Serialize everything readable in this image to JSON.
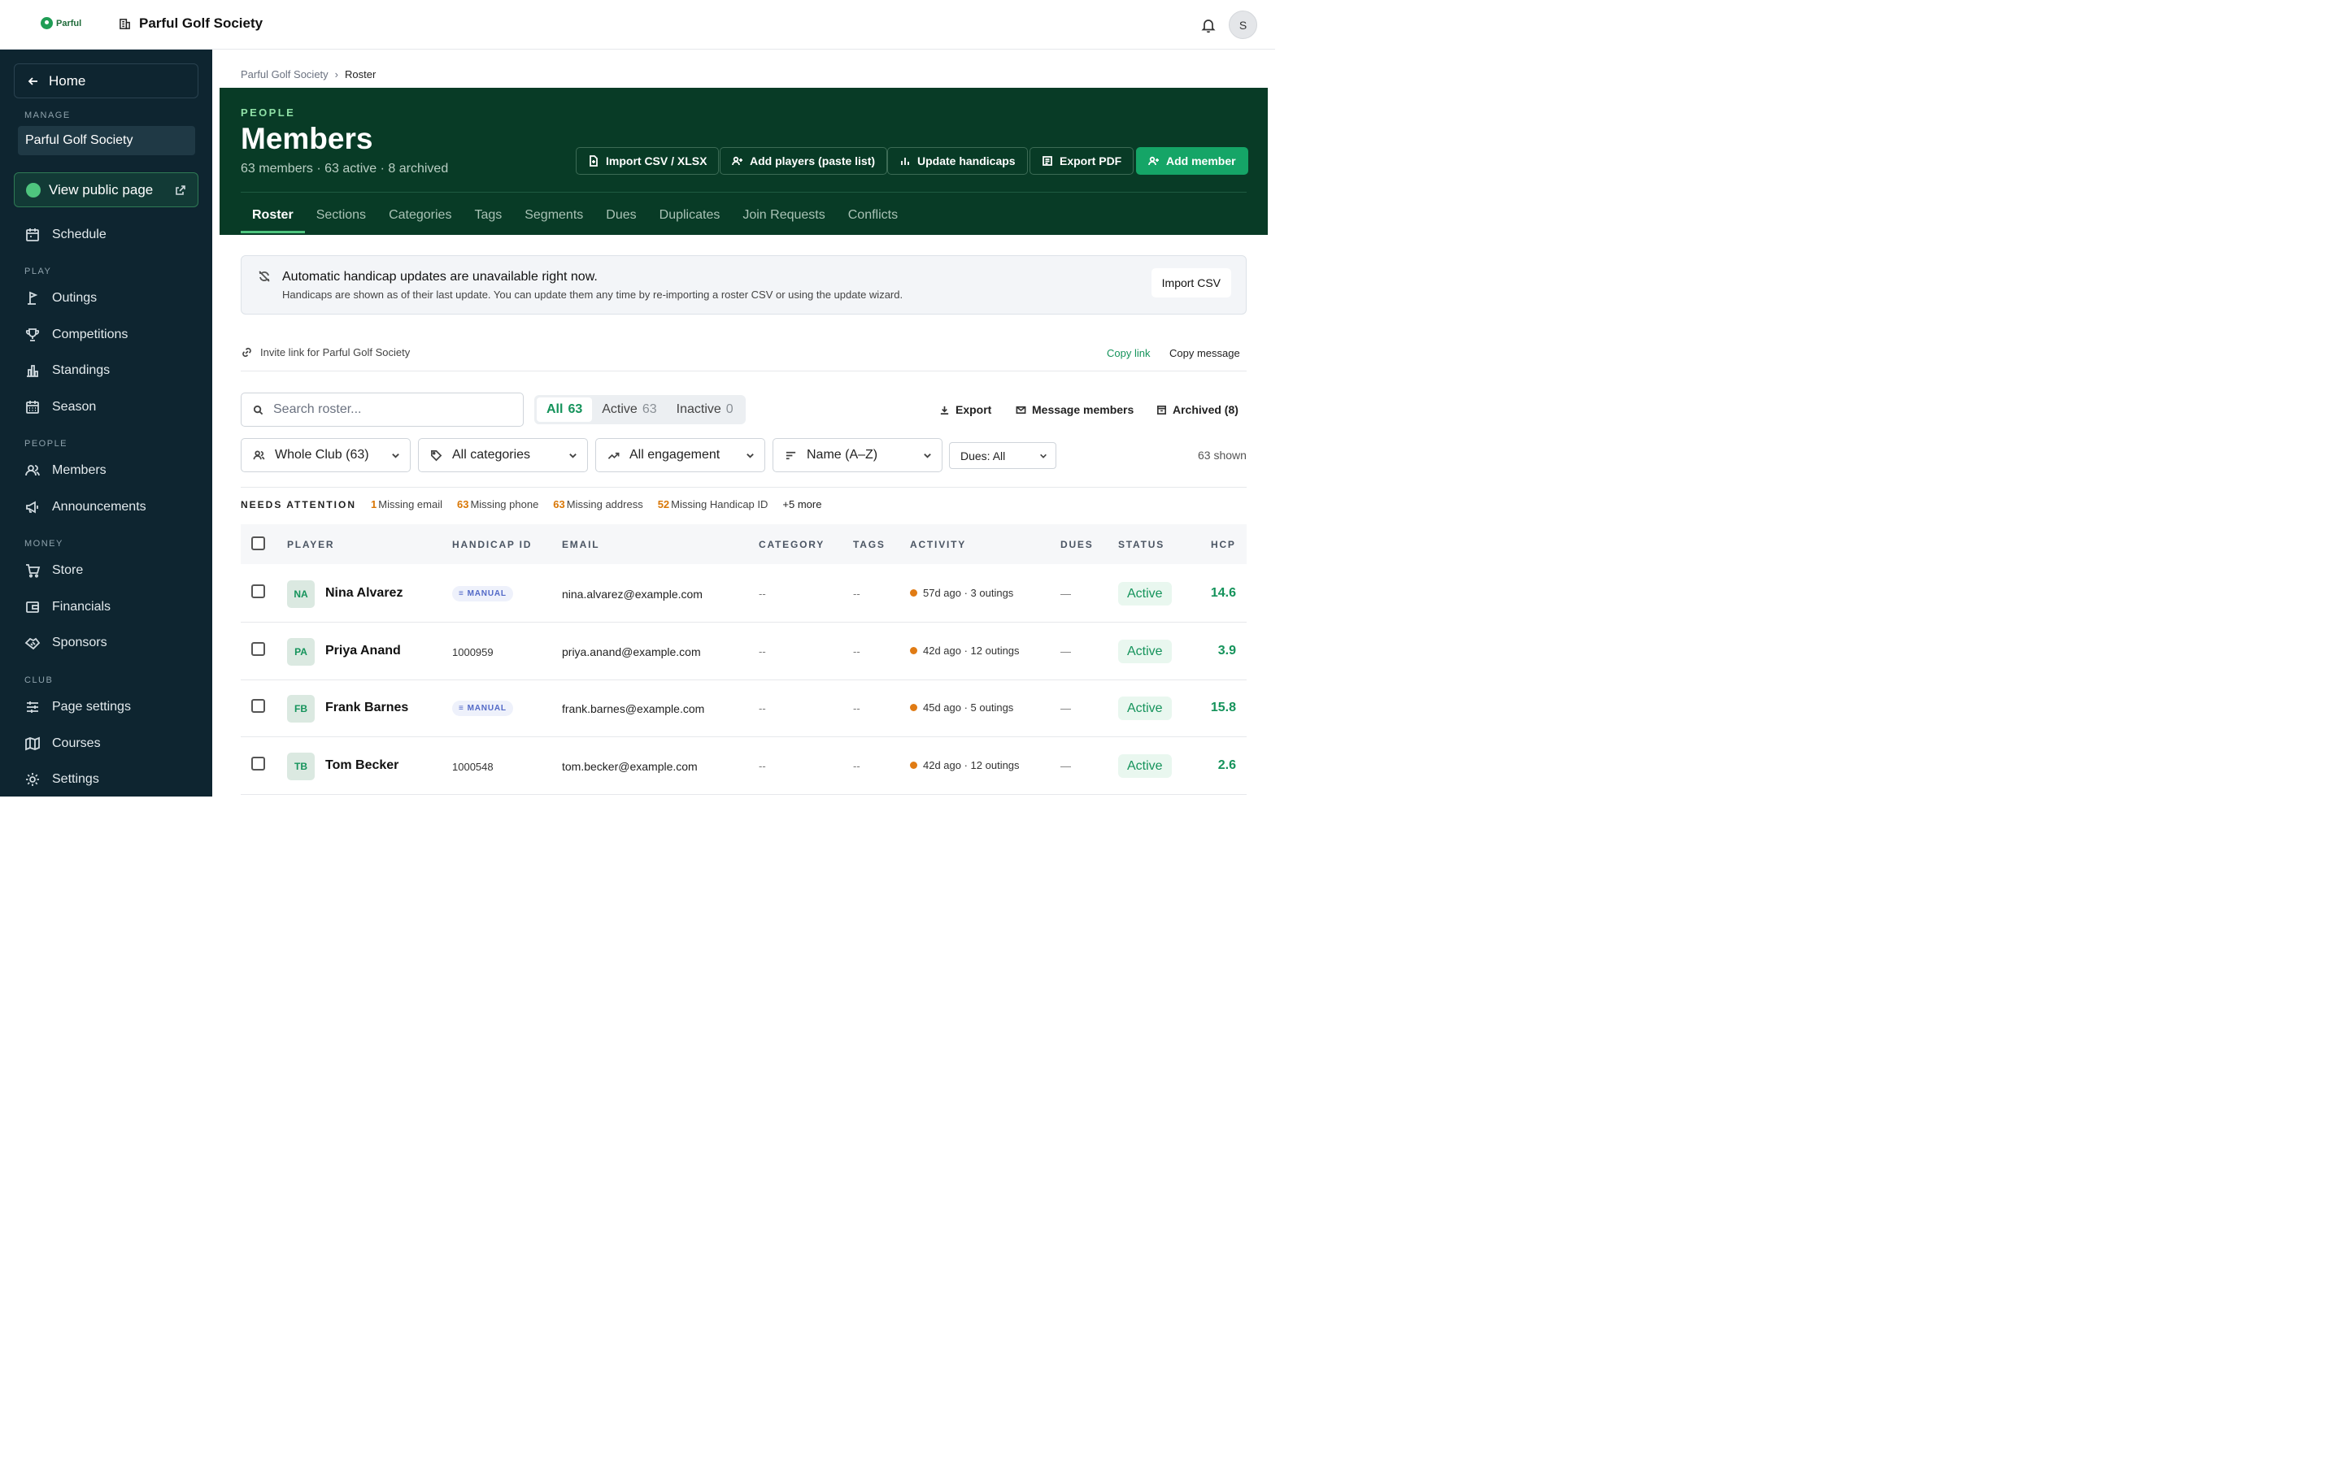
{
  "topbar": {
    "logo_text": "Parful",
    "org_name": "Parful Golf Society",
    "avatar_initial": "S"
  },
  "sidebar": {
    "home_label": "Home",
    "manage_label": "MANAGE",
    "manage_org": "Parful Golf Society",
    "public_page_label": "View public page",
    "schedule_label": "Schedule",
    "play_label": "PLAY",
    "play_items": [
      "Outings",
      "Competitions",
      "Standings",
      "Season"
    ],
    "people_label": "PEOPLE",
    "people_items": [
      "Members",
      "Announcements"
    ],
    "money_label": "MONEY",
    "money_items": [
      "Store",
      "Financials",
      "Sponsors"
    ],
    "club_label": "CLUB",
    "club_items": [
      "Page settings",
      "Courses",
      "Settings"
    ]
  },
  "breadcrumb": {
    "parent": "Parful Golf Society",
    "current": "Roster"
  },
  "hero": {
    "eyebrow": "PEOPLE",
    "title": "Members",
    "subtitle": "63 members · 63 active · 8 archived",
    "buttons": [
      "Import CSV / XLSX",
      "Add players (paste list)",
      "Update handicaps",
      "Export PDF",
      "Add member"
    ],
    "tabs": [
      "Roster",
      "Sections",
      "Categories",
      "Tags",
      "Segments",
      "Dues",
      "Duplicates",
      "Join Requests",
      "Conflicts"
    ]
  },
  "banner": {
    "title": "Automatic handicap updates are unavailable right now.",
    "body": "Handicaps are shown as of their last update. You can update them any time by re-importing a roster CSV or using the update wizard.",
    "button": "Import CSV"
  },
  "invite": {
    "text": "Invite link for Parful Golf Society",
    "copy_link": "Copy link",
    "copy_message": "Copy message"
  },
  "toolbar": {
    "search_placeholder": "Search roster...",
    "seg_all": "All",
    "seg_all_count": "63",
    "seg_active": "Active",
    "seg_active_count": "63",
    "seg_inactive": "Inactive",
    "seg_inactive_count": "0",
    "export": "Export",
    "message": "Message members",
    "archived": "Archived (8)"
  },
  "filters": {
    "section": "Whole Club (63)",
    "category": "All categories",
    "engagement": "All engagement",
    "sort": "Name (A–Z)",
    "dues": "Dues: All",
    "shown": "63 shown"
  },
  "attention": {
    "label": "NEEDS ATTENTION",
    "items": [
      {
        "n": "1",
        "text": "Missing email"
      },
      {
        "n": "63",
        "text": "Missing phone"
      },
      {
        "n": "63",
        "text": "Missing address"
      },
      {
        "n": "52",
        "text": "Missing Handicap ID"
      }
    ],
    "more": "+5 more"
  },
  "table": {
    "headers": {
      "player": "PLAYER",
      "handicap_id": "HANDICAP ID",
      "email": "EMAIL",
      "category": "CATEGORY",
      "tags": "TAGS",
      "activity": "ACTIVITY",
      "dues": "DUES",
      "status": "STATUS",
      "hcp": "HCP"
    },
    "manual_label": "MANUAL",
    "rows": [
      {
        "initials": "NA",
        "name": "Nina Alvarez",
        "handicap_id": "",
        "email": "nina.alvarez@example.com",
        "category": "--",
        "tags": "--",
        "activity": "57d ago · 3 outings",
        "dues": "—",
        "status": "Active",
        "hcp": "14.6"
      },
      {
        "initials": "PA",
        "name": "Priya Anand",
        "handicap_id": "1000959",
        "email": "priya.anand@example.com",
        "category": "--",
        "tags": "--",
        "activity": "42d ago · 12 outings",
        "dues": "—",
        "status": "Active",
        "hcp": "3.9"
      },
      {
        "initials": "FB",
        "name": "Frank Barnes",
        "handicap_id": "",
        "email": "frank.barnes@example.com",
        "category": "--",
        "tags": "--",
        "activity": "45d ago · 5 outings",
        "dues": "—",
        "status": "Active",
        "hcp": "15.8"
      },
      {
        "initials": "TB",
        "name": "Tom Becker",
        "handicap_id": "1000548",
        "email": "tom.becker@example.com",
        "category": "--",
        "tags": "--",
        "activity": "42d ago · 12 outings",
        "dues": "—",
        "status": "Active",
        "hcp": "2.6"
      }
    ]
  }
}
